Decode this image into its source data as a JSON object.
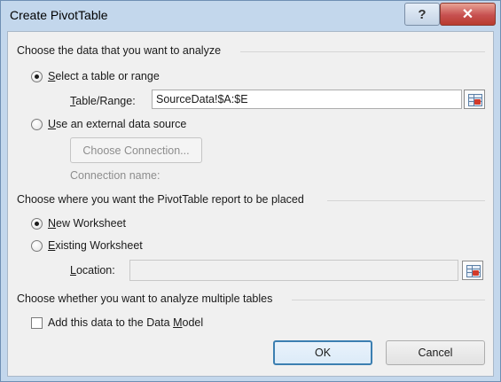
{
  "window": {
    "title": "Create PivotTable",
    "help_glyph": "?",
    "close_glyph": "✕"
  },
  "section_data": {
    "heading": "Choose the data that you want to analyze",
    "option_table": {
      "mnemonic": "S",
      "rest": "elect a table or range",
      "checked": true
    },
    "table_range": {
      "label_mnemonic": "T",
      "label_rest": "able/Range:",
      "value": "SourceData!$A:$E"
    },
    "option_external": {
      "mnemonic": "U",
      "rest": "se an external data source",
      "checked": false
    },
    "choose_connection_label": "Choose Connection...",
    "connection_name_label": "Connection name:"
  },
  "section_place": {
    "heading": "Choose where you want the PivotTable report to be placed",
    "option_new": {
      "mnemonic": "N",
      "rest": "ew Worksheet",
      "checked": true
    },
    "option_existing": {
      "mnemonic": "E",
      "rest": "xisting Worksheet",
      "checked": false
    },
    "location": {
      "label_mnemonic": "L",
      "label_rest": "ocation:",
      "value": ""
    }
  },
  "section_multi": {
    "heading": "Choose whether you want to analyze multiple tables",
    "checkbox": {
      "before": "Add this data to the Data ",
      "mnemonic": "M",
      "after": "odel",
      "checked": false
    }
  },
  "buttons": {
    "ok_label": "OK",
    "cancel_label": "Cancel"
  }
}
